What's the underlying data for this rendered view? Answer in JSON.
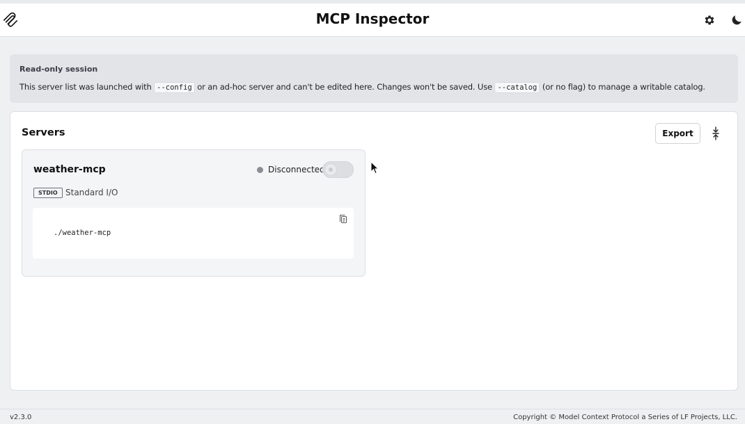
{
  "app": {
    "title": "MCP Inspector",
    "logo_icon": "mcp-logo-icon",
    "settings_icon": "gear-icon",
    "theme_icon": "moon-icon"
  },
  "banner": {
    "title": "Read-only session",
    "text_part1": "This server list was launched with ",
    "code1": "--config",
    "text_part2": " or an ad-hoc server and can't be edited here. Changes won't be saved. Use ",
    "code2": "--catalog",
    "text_part3": " (or no flag) to manage a writable catalog."
  },
  "servers_panel": {
    "title": "Servers",
    "export_label": "Export",
    "collapse_icon": "collapse-icon"
  },
  "server_card": {
    "name": "weather-mcp",
    "status": "Disconnected",
    "status_color": "#8a8d93",
    "connected": false,
    "transport_badge": "STDIO",
    "transport_label": "Standard I/O",
    "command": "./weather-mcp",
    "copy_icon": "copy-icon"
  },
  "footer": {
    "version": "v2.3.0",
    "copyright": "Copyright © Model Context Protocol a Series of LF Projects, LLC."
  }
}
